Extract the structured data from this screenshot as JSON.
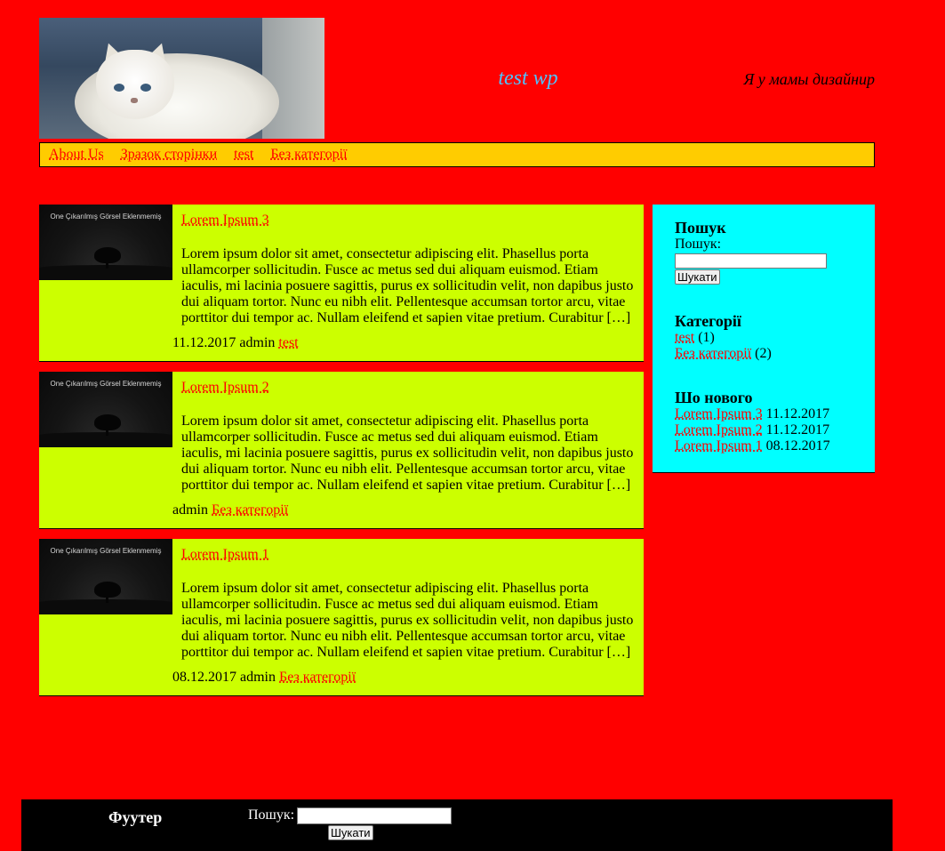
{
  "header": {
    "site_title": "test wp",
    "tagline": "Я у мамы дизайнир"
  },
  "nav": {
    "items": [
      "About Us",
      "Зразок сторінки",
      "test",
      "Без категорії"
    ]
  },
  "posts": [
    {
      "title": "Lorem Ipsum 3",
      "thumb_text": "One Çıkarılmış Görsel Eklenmemiş",
      "excerpt": "Lorem ipsum dolor sit amet, consectetur adipiscing elit. Phasellus porta ullamcorper sollicitudin. Fusce ac metus sed dui aliquam euismod. Etiam iaculis, mi lacinia posuere sagittis, purus ex sollicitudin velit, non dapibus justo dui aliquam tortor. Nunc eu nibh elit. Pellentesque accumsan tortor arcu, vitae porttitor dui tempor ac. Nullam eleifend et sapien vitae pretium. Curabitur […]",
      "date": "11.12.2017",
      "author": "admin",
      "category": "test"
    },
    {
      "title": "Lorem Ipsum 2",
      "thumb_text": "One Çıkarılmış Görsel Eklenmemiş",
      "excerpt": "Lorem ipsum dolor sit amet, consectetur adipiscing elit. Phasellus porta ullamcorper sollicitudin. Fusce ac metus sed dui aliquam euismod. Etiam iaculis, mi lacinia posuere sagittis, purus ex sollicitudin velit, non dapibus justo dui aliquam tortor. Nunc eu nibh elit. Pellentesque accumsan tortor arcu, vitae porttitor dui tempor ac. Nullam eleifend et sapien vitae pretium. Curabitur […]",
      "date": "",
      "author": "admin",
      "category": "Без категорії"
    },
    {
      "title": "Lorem Ipsum 1",
      "thumb_text": "One Çıkarılmış Görsel Eklenmemiş",
      "excerpt": "Lorem ipsum dolor sit amet, consectetur adipiscing elit. Phasellus porta ullamcorper sollicitudin. Fusce ac metus sed dui aliquam euismod. Etiam iaculis, mi lacinia posuere sagittis, purus ex sollicitudin velit, non dapibus justo dui aliquam tortor. Nunc eu nibh elit. Pellentesque accumsan tortor arcu, vitae porttitor dui tempor ac. Nullam eleifend et sapien vitae pretium. Curabitur […]",
      "date": "08.12.2017",
      "author": "admin",
      "category": "Без категорії"
    }
  ],
  "sidebar": {
    "search": {
      "title": "Пошук",
      "label": "Пошук:",
      "value": "",
      "button": "Шукати"
    },
    "categories": {
      "title": "Категорії",
      "items": [
        {
          "name": "test",
          "count": "(1)"
        },
        {
          "name": "Без категорії",
          "count": "(2)"
        }
      ]
    },
    "recent": {
      "title": "Шо нового",
      "items": [
        {
          "title": "Lorem Ipsum 3",
          "date": "11.12.2017"
        },
        {
          "title": "Lorem Ipsum 2",
          "date": "11.12.2017"
        },
        {
          "title": "Lorem Ipsum 1",
          "date": "08.12.2017"
        }
      ]
    }
  },
  "footer": {
    "title": "Фуутер",
    "search_label": "Пошук:",
    "search_value": "",
    "button": "Шукати"
  },
  "colors": {
    "page_bg": "#ff0000",
    "nav_bg": "#ffcc00",
    "post_bg": "#ccff00",
    "sidebar_bg": "#00ffff",
    "footer_bg": "#000000",
    "site_title": "#4fc3ff",
    "link": "#ff0000"
  }
}
